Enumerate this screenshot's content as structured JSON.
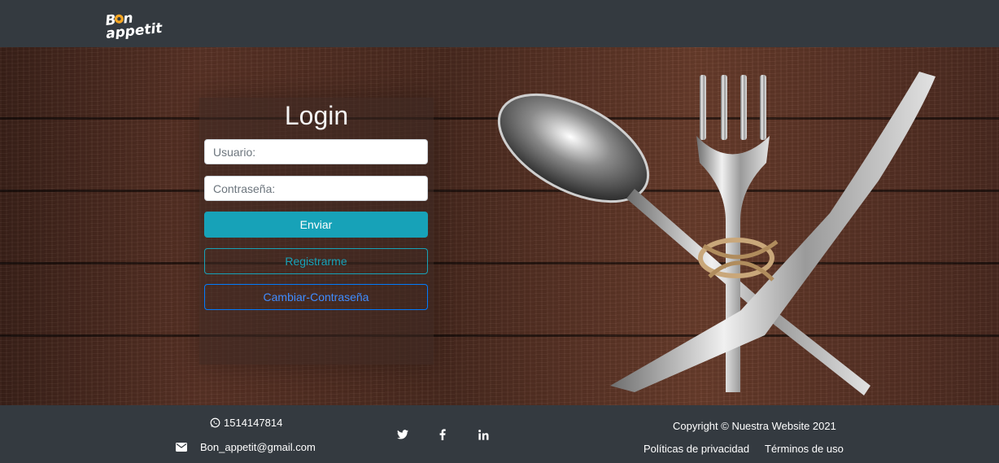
{
  "header": {
    "logo_text": "Bon appetit"
  },
  "login": {
    "title": "Login",
    "username_placeholder": "Usuario:",
    "password_placeholder": "Contraseña:",
    "submit_label": "Enviar",
    "register_label": "Registrarme",
    "change_password_label": "Cambiar-Contraseña"
  },
  "footer": {
    "phone": "1514147814",
    "email": "Bon_appetit@gmail.com",
    "social": [
      "twitter-icon",
      "facebook-icon",
      "linkedin-icon"
    ],
    "copyright": "Copyright © Nuestra Website 2021",
    "privacy_label": "Políticas de privacidad",
    "terms_label": "Términos de uso"
  },
  "colors": {
    "navbar": "#343a40",
    "accent_info": "#17a2b8",
    "accent_primary": "#007bff",
    "logo_orange": "#f5a623"
  }
}
